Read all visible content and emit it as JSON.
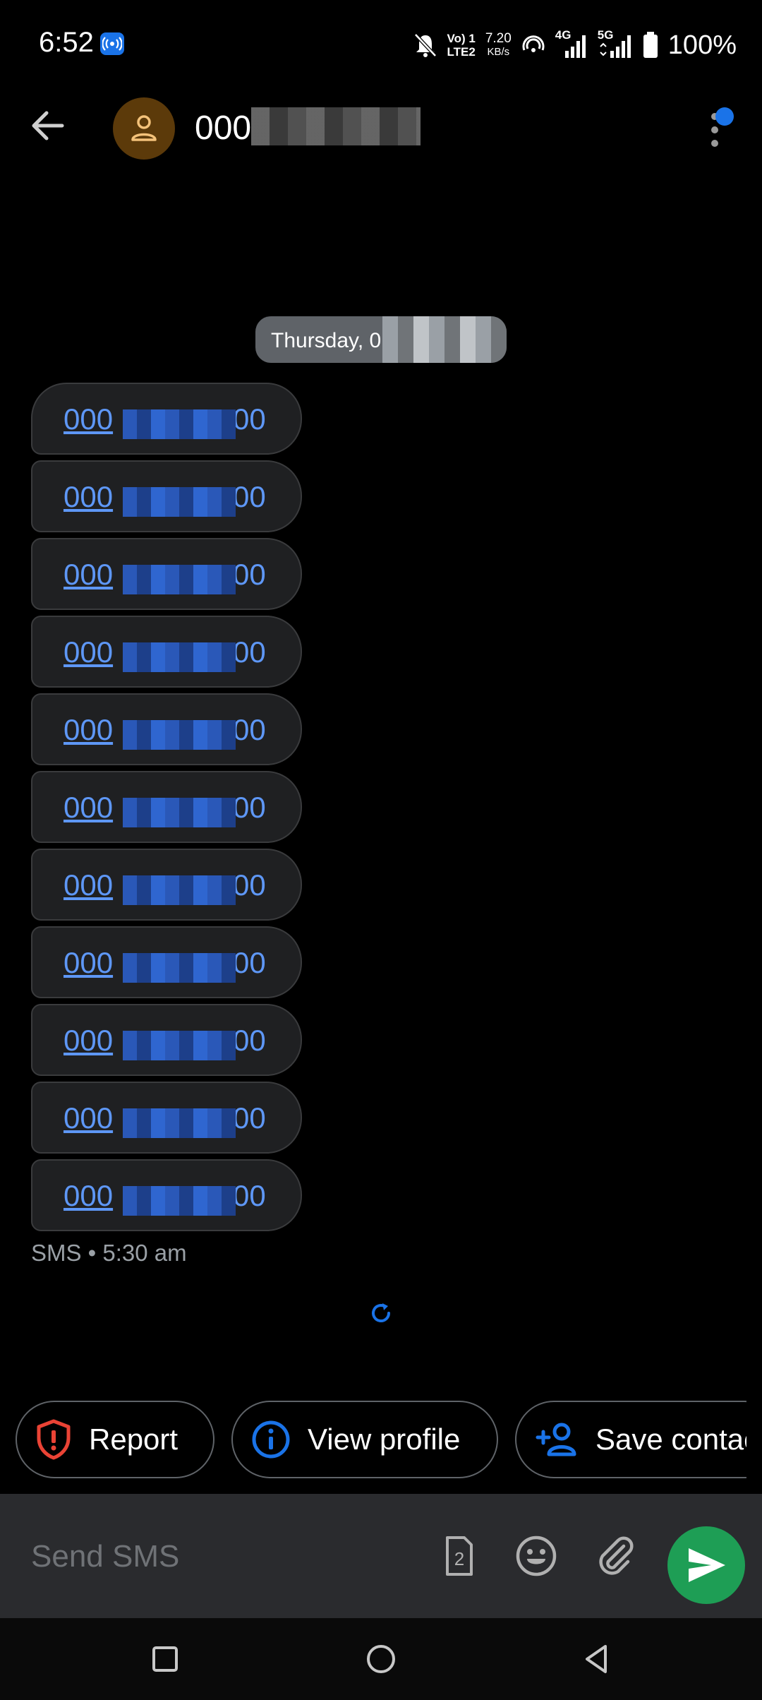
{
  "status_bar": {
    "time": "6:52",
    "volte_line1": "Vo) 1",
    "volte_line2": "LTE2",
    "speed_value": "7.20",
    "speed_unit": "KB/s",
    "net1": "4G",
    "net2": "5G",
    "battery": "100%"
  },
  "header": {
    "contact_name": "000"
  },
  "date_chip": "Thursday, 0",
  "messages": [
    {
      "prefix": "000",
      "suffix": "00"
    },
    {
      "prefix": "000",
      "suffix": "00"
    },
    {
      "prefix": "000",
      "suffix": "00"
    },
    {
      "prefix": "000",
      "suffix": "00"
    },
    {
      "prefix": "000",
      "suffix": "00"
    },
    {
      "prefix": "000",
      "suffix": "00"
    },
    {
      "prefix": "000",
      "suffix": "00"
    },
    {
      "prefix": "000",
      "suffix": "00"
    },
    {
      "prefix": "000",
      "suffix": "00"
    },
    {
      "prefix": "000",
      "suffix": "00"
    },
    {
      "prefix": "000",
      "suffix": "00"
    }
  ],
  "message_meta": "SMS • 5:30 am",
  "chips": {
    "report": "Report",
    "view_profile": "View profile",
    "save_contact": "Save contact"
  },
  "compose": {
    "placeholder": "Send SMS",
    "sim_number": "2"
  },
  "colors": {
    "link": "#5e97f6",
    "accent": "#1a73e8",
    "send": "#1e9e55",
    "report": "#ea4335"
  }
}
